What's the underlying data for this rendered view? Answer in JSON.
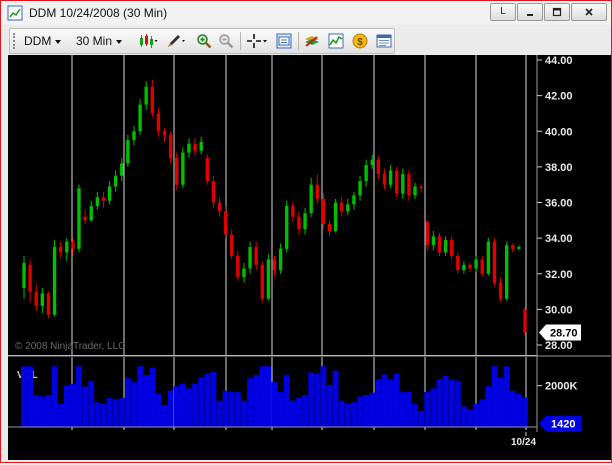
{
  "window": {
    "title": "DDM  10/24/2008 (30 Min)",
    "btn_l": "L"
  },
  "toolbar": {
    "instrument": "DDM",
    "interval": "30 Min"
  },
  "chart": {
    "copyright": "© 2008 NinjaTrader, LLC",
    "vol_label": "VOL",
    "price_ticks": [
      "44.00",
      "42.00",
      "40.00",
      "38.00",
      "36.00",
      "34.00",
      "32.00",
      "30.00",
      "28.00"
    ],
    "vol_tick": "2000K",
    "last_price": "28.70",
    "last_volume": "1420",
    "date_label": "10/24",
    "colors": {
      "up": "#00c000",
      "down": "#e00000",
      "volume": "#0000e0",
      "background": "#000000",
      "price_badge": "#ffffff",
      "volume_badge": "#0000e0"
    }
  },
  "chart_data": {
    "type": "candlestick",
    "ylim": [
      28,
      44
    ],
    "candles": [
      {
        "o": 31.2,
        "c": 32.6,
        "h": 33.0,
        "l": 30.6
      },
      {
        "o": 32.5,
        "c": 31.0,
        "h": 32.8,
        "l": 30.4
      },
      {
        "o": 31.0,
        "c": 30.2,
        "h": 31.4,
        "l": 29.9
      },
      {
        "o": 30.2,
        "c": 30.9,
        "h": 31.2,
        "l": 29.8
      },
      {
        "o": 30.9,
        "c": 29.7,
        "h": 31.0,
        "l": 29.5
      },
      {
        "o": 29.7,
        "c": 33.5,
        "h": 33.9,
        "l": 29.6
      },
      {
        "o": 33.5,
        "c": 33.2,
        "h": 33.8,
        "l": 32.9
      },
      {
        "o": 33.2,
        "c": 33.8,
        "h": 34.0,
        "l": 32.7
      },
      {
        "o": 33.8,
        "c": 33.4,
        "h": 34.0,
        "l": 33.0
      },
      {
        "o": 33.4,
        "c": 36.8,
        "h": 37.0,
        "l": 33.2
      },
      {
        "o": 35.2,
        "c": 35.0,
        "h": 35.6,
        "l": 34.8
      },
      {
        "o": 35.0,
        "c": 35.8,
        "h": 36.1,
        "l": 34.9
      },
      {
        "o": 35.8,
        "c": 36.3,
        "h": 36.6,
        "l": 35.6
      },
      {
        "o": 36.3,
        "c": 36.1,
        "h": 36.6,
        "l": 35.7
      },
      {
        "o": 36.1,
        "c": 36.9,
        "h": 37.2,
        "l": 35.9
      },
      {
        "o": 36.9,
        "c": 37.5,
        "h": 37.8,
        "l": 36.6
      },
      {
        "o": 37.5,
        "c": 38.2,
        "h": 38.5,
        "l": 37.2
      },
      {
        "o": 38.2,
        "c": 39.5,
        "h": 39.8,
        "l": 38.0
      },
      {
        "o": 39.5,
        "c": 40.0,
        "h": 40.3,
        "l": 39.2
      },
      {
        "o": 40.0,
        "c": 41.5,
        "h": 41.8,
        "l": 39.8
      },
      {
        "o": 41.5,
        "c": 42.5,
        "h": 42.8,
        "l": 41.2
      },
      {
        "o": 42.5,
        "c": 41.0,
        "h": 42.9,
        "l": 40.8
      },
      {
        "o": 41.0,
        "c": 40.0,
        "h": 41.3,
        "l": 39.7
      },
      {
        "o": 40.0,
        "c": 39.8,
        "h": 40.2,
        "l": 39.4
      },
      {
        "o": 39.8,
        "c": 38.5,
        "h": 40.0,
        "l": 38.2
      },
      {
        "o": 38.5,
        "c": 37.0,
        "h": 38.8,
        "l": 36.7
      },
      {
        "o": 37.0,
        "c": 38.8,
        "h": 39.1,
        "l": 36.8
      },
      {
        "o": 38.8,
        "c": 39.3,
        "h": 39.6,
        "l": 38.5
      },
      {
        "o": 39.3,
        "c": 38.9,
        "h": 39.6,
        "l": 38.6
      },
      {
        "o": 38.9,
        "c": 39.4,
        "h": 39.7,
        "l": 38.7
      },
      {
        "o": 38.5,
        "c": 37.2,
        "h": 38.7,
        "l": 37.0
      },
      {
        "o": 37.2,
        "c": 36.0,
        "h": 37.5,
        "l": 35.7
      },
      {
        "o": 36.0,
        "c": 35.5,
        "h": 36.3,
        "l": 35.2
      },
      {
        "o": 35.5,
        "c": 34.2,
        "h": 35.8,
        "l": 34.0
      },
      {
        "o": 34.2,
        "c": 33.0,
        "h": 34.5,
        "l": 32.8
      },
      {
        "o": 33.0,
        "c": 31.8,
        "h": 33.3,
        "l": 31.6
      },
      {
        "o": 31.8,
        "c": 32.3,
        "h": 32.6,
        "l": 31.5
      },
      {
        "o": 32.3,
        "c": 33.5,
        "h": 33.8,
        "l": 32.0
      },
      {
        "o": 33.5,
        "c": 32.5,
        "h": 33.8,
        "l": 32.2
      },
      {
        "o": 32.5,
        "c": 30.6,
        "h": 32.7,
        "l": 30.4
      },
      {
        "o": 30.6,
        "c": 32.8,
        "h": 33.1,
        "l": 30.5
      },
      {
        "o": 32.8,
        "c": 32.2,
        "h": 33.0,
        "l": 31.9
      },
      {
        "o": 32.2,
        "c": 33.4,
        "h": 33.7,
        "l": 32.0
      },
      {
        "o": 33.4,
        "c": 35.8,
        "h": 36.1,
        "l": 33.2
      },
      {
        "o": 35.8,
        "c": 35.2,
        "h": 36.0,
        "l": 34.9
      },
      {
        "o": 35.2,
        "c": 34.5,
        "h": 35.5,
        "l": 34.2
      },
      {
        "o": 34.5,
        "c": 35.4,
        "h": 35.7,
        "l": 34.2
      },
      {
        "o": 35.4,
        "c": 37.0,
        "h": 37.4,
        "l": 35.2
      },
      {
        "o": 37.0,
        "c": 36.2,
        "h": 37.6,
        "l": 35.9
      },
      {
        "o": 36.2,
        "c": 34.8,
        "h": 36.5,
        "l": 34.5
      },
      {
        "o": 34.8,
        "c": 34.4,
        "h": 35.0,
        "l": 34.1
      },
      {
        "o": 34.4,
        "c": 36.0,
        "h": 36.2,
        "l": 34.3
      },
      {
        "o": 36.0,
        "c": 35.5,
        "h": 36.3,
        "l": 35.2
      },
      {
        "o": 35.5,
        "c": 35.9,
        "h": 36.2,
        "l": 35.3
      },
      {
        "o": 35.9,
        "c": 36.4,
        "h": 36.6,
        "l": 35.6
      },
      {
        "o": 36.4,
        "c": 37.2,
        "h": 37.5,
        "l": 36.1
      },
      {
        "o": 37.2,
        "c": 38.1,
        "h": 38.4,
        "l": 36.9
      },
      {
        "o": 38.1,
        "c": 38.4,
        "h": 38.7,
        "l": 37.9
      },
      {
        "o": 38.4,
        "c": 37.6,
        "h": 38.6,
        "l": 37.3
      },
      {
        "o": 37.6,
        "c": 37.0,
        "h": 37.9,
        "l": 36.7
      },
      {
        "o": 37.0,
        "c": 37.8,
        "h": 38.1,
        "l": 36.8
      },
      {
        "o": 37.8,
        "c": 36.5,
        "h": 38.0,
        "l": 36.3
      },
      {
        "o": 36.5,
        "c": 37.6,
        "h": 37.9,
        "l": 36.2
      },
      {
        "o": 37.6,
        "c": 36.4,
        "h": 37.8,
        "l": 36.1
      },
      {
        "o": 36.4,
        "c": 36.9,
        "h": 37.1,
        "l": 36.2
      },
      {
        "o": 36.9,
        "c": 36.8,
        "h": 37.0,
        "l": 36.6
      },
      {
        "o": 34.9,
        "c": 33.6,
        "h": 35.0,
        "l": 33.3
      },
      {
        "o": 33.6,
        "c": 34.1,
        "h": 34.4,
        "l": 33.3
      },
      {
        "o": 34.1,
        "c": 33.2,
        "h": 34.3,
        "l": 33.0
      },
      {
        "o": 33.2,
        "c": 33.9,
        "h": 34.1,
        "l": 33.0
      },
      {
        "o": 33.9,
        "c": 33.0,
        "h": 34.1,
        "l": 32.8
      },
      {
        "o": 33.0,
        "c": 32.2,
        "h": 33.2,
        "l": 32.0
      },
      {
        "o": 32.2,
        "c": 32.5,
        "h": 32.7,
        "l": 32.0
      },
      {
        "o": 32.5,
        "c": 32.3,
        "h": 32.6,
        "l": 32.1
      },
      {
        "o": 32.3,
        "c": 32.8,
        "h": 33.0,
        "l": 32.1
      },
      {
        "o": 32.8,
        "c": 32.0,
        "h": 33.0,
        "l": 31.8
      },
      {
        "o": 32.0,
        "c": 33.8,
        "h": 34.0,
        "l": 31.9
      },
      {
        "o": 33.8,
        "c": 31.5,
        "h": 34.0,
        "l": 31.3
      },
      {
        "o": 31.5,
        "c": 30.6,
        "h": 31.8,
        "l": 30.4
      },
      {
        "o": 30.6,
        "c": 33.6,
        "h": 33.8,
        "l": 30.5
      },
      {
        "o": 33.6,
        "c": 33.4,
        "h": 33.7,
        "l": 33.2
      },
      {
        "o": 33.4,
        "c": 33.5,
        "h": 33.6,
        "l": 33.3
      },
      {
        "o": 30.0,
        "c": 28.7,
        "h": 30.1,
        "l": 28.6
      }
    ],
    "volume_max_k": 3000
  }
}
